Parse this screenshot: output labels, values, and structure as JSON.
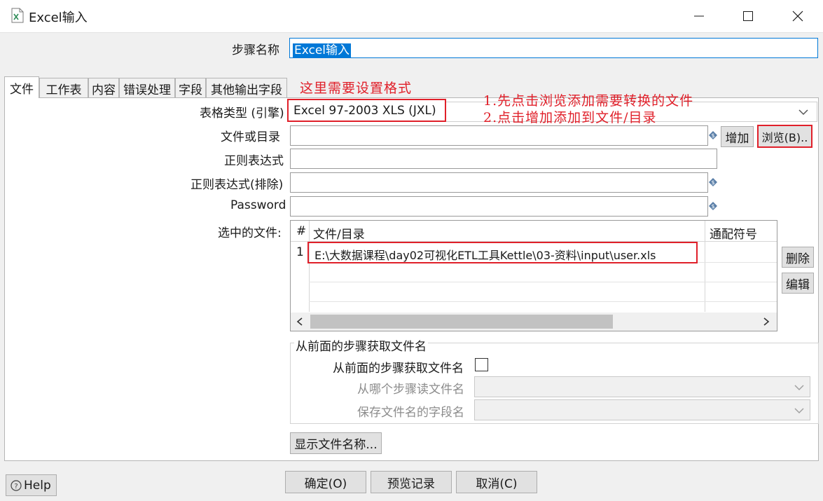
{
  "window": {
    "title": "Excel输入",
    "controls": {
      "minimize": "—",
      "maximize": "☐",
      "close": "✕"
    }
  },
  "step_name": {
    "label": "步骤名称",
    "value": "Excel输入"
  },
  "tabs": [
    "文件",
    "工作表",
    "内容",
    "错误处理",
    "字段",
    "其他输出字段"
  ],
  "file_tab": {
    "spreadsheet_type": {
      "label": "表格类型 (引擎)",
      "value": "Excel 97-2003 XLS (JXL)"
    },
    "file_or_dir": {
      "label": "文件或目录",
      "value": ""
    },
    "add_button": "增加",
    "browse_button": "浏览(B)..",
    "regex": {
      "label": "正则表达式",
      "value": ""
    },
    "regex_exclude": {
      "label": "正则表达式(排除)",
      "value": ""
    },
    "password": {
      "label": "Password",
      "value": ""
    },
    "selected_files": {
      "label": "选中的文件:",
      "columns": [
        "#",
        "文件/目录",
        "通配符号"
      ],
      "rows": [
        {
          "index": "1",
          "path": "E:\\大数据课程\\day02可视化ETL工具Kettle\\03-资料\\input\\user.xls",
          "wildcard": ""
        }
      ]
    },
    "delete_button": "删除",
    "edit_button": "编辑",
    "from_previous": {
      "group_title": "从前面的步骤获取文件名",
      "checkbox_label": "从前面的步骤获取文件名",
      "checked": false,
      "step_to_read_label": "从哪个步骤读文件名",
      "field_holding_label": "保存文件名的字段名"
    },
    "show_filenames_button": "显示文件名称..."
  },
  "annotations": {
    "format_note": "这里需要设置格式",
    "step1": "1.先点击浏览添加需要转换的文件",
    "step2": "2.点击增加添加到文件/目录"
  },
  "footer": {
    "help": "Help",
    "ok": "确定(O)",
    "preview": "预览记录",
    "cancel": "取消(C)"
  },
  "colors": {
    "annotation_red": "#e0202a",
    "selection_blue": "#0078d7"
  }
}
